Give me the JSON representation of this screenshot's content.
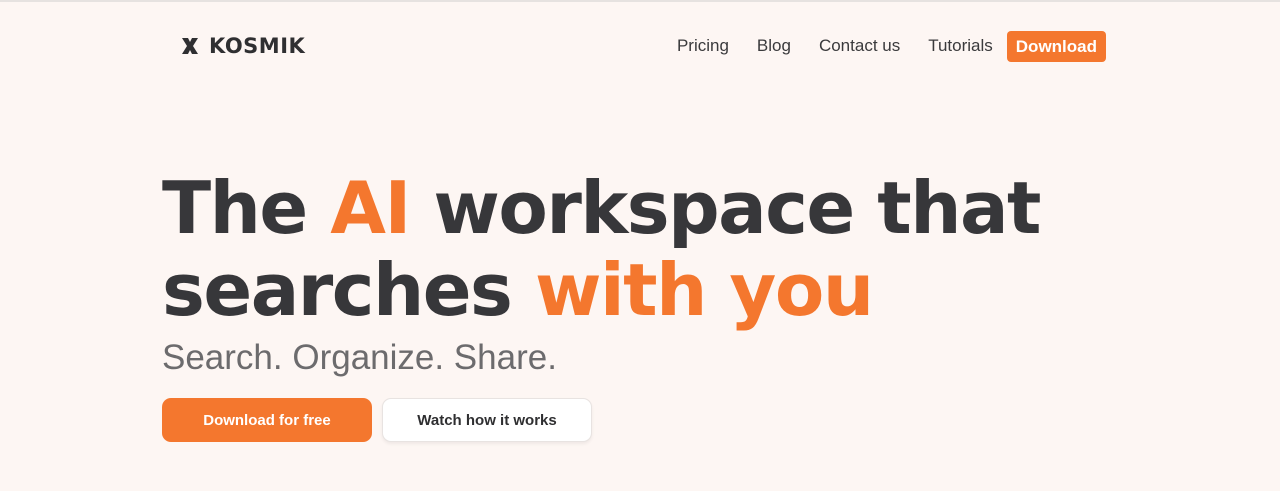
{
  "brand": {
    "name": "KOSMIK",
    "icon": "kosmik-x-logo-icon",
    "accent_color": "#f4772e"
  },
  "nav": {
    "links": [
      "Pricing",
      "Blog",
      "Contact us",
      "Tutorials"
    ],
    "download_label": "Download"
  },
  "hero": {
    "headline_part1": "The ",
    "headline_accent1": "AI",
    "headline_part2": " workspace that",
    "headline_part3": "searches ",
    "headline_accent2": "with you",
    "subheadline": "Search. Organize. Share.",
    "primary_cta": "Download for free",
    "secondary_cta": "Watch how it works"
  }
}
